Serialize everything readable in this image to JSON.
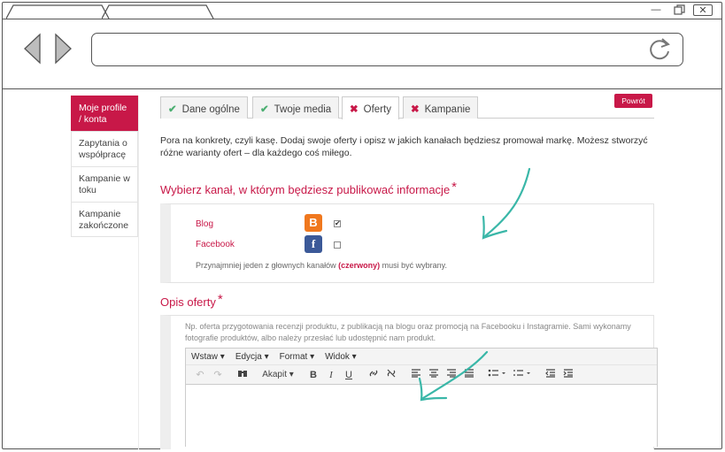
{
  "window": {
    "minimize": "—",
    "close": "✕"
  },
  "sidebar": {
    "items": [
      {
        "label": "Moje profile / konta",
        "active": true
      },
      {
        "label": "Zapytania o współpracę",
        "active": false
      },
      {
        "label": "Kampanie w toku",
        "active": false
      },
      {
        "label": "Kampanie zakończone",
        "active": false
      }
    ]
  },
  "tabs": [
    {
      "label": "Dane ogólne",
      "status": "done",
      "icon": "✔"
    },
    {
      "label": "Twoje media",
      "status": "done",
      "icon": "✔"
    },
    {
      "label": "Oferty",
      "status": "active",
      "icon": "✖"
    },
    {
      "label": "Kampanie",
      "status": "todo",
      "icon": "✖"
    }
  ],
  "back_button": "Powrót",
  "intro": "Pora na konkrety, czyli kasę. Dodaj swoje oferty i opisz w jakich kanałach będziesz promował markę. Możesz stworzyć różne warianty ofert – dla każdego coś miłego.",
  "channels_section": {
    "title": "Wybierz kanał, w którym będziesz publikować informacje",
    "required_mark": "*",
    "channels": [
      {
        "name": "Blog",
        "icon": "blogger-icon",
        "icon_char": "B",
        "checked": true
      },
      {
        "name": "Facebook",
        "icon": "facebook-icon",
        "icon_char": "f",
        "checked": false
      }
    ],
    "hint_before": "Przynajmniej jeden z głownych kanałów",
    "hint_highlight": "(czerwony)",
    "hint_after": "musi być wybrany."
  },
  "offer_section": {
    "title": "Opis oferty",
    "required_mark": "*",
    "placeholder": "Np. oferta przygotowania recenzji produktu, z publikacją na blogu oraz promocją na Facebooku i Instagramie. Sami wykonamy fotografie produktów, albo należy przesłać lub udostępnić nam produkt.",
    "editor_menu": [
      "Wstaw ▾",
      "Edycja ▾",
      "Format ▾",
      "Widok ▾"
    ],
    "paragraph_select": "Akapit ▾",
    "toolbar": {
      "bold": "B",
      "italic": "I",
      "underline": "U"
    }
  },
  "colors": {
    "accent": "#c81848",
    "check_green": "#4caf72",
    "blogger": "#f0781e",
    "facebook": "#3b5998"
  }
}
